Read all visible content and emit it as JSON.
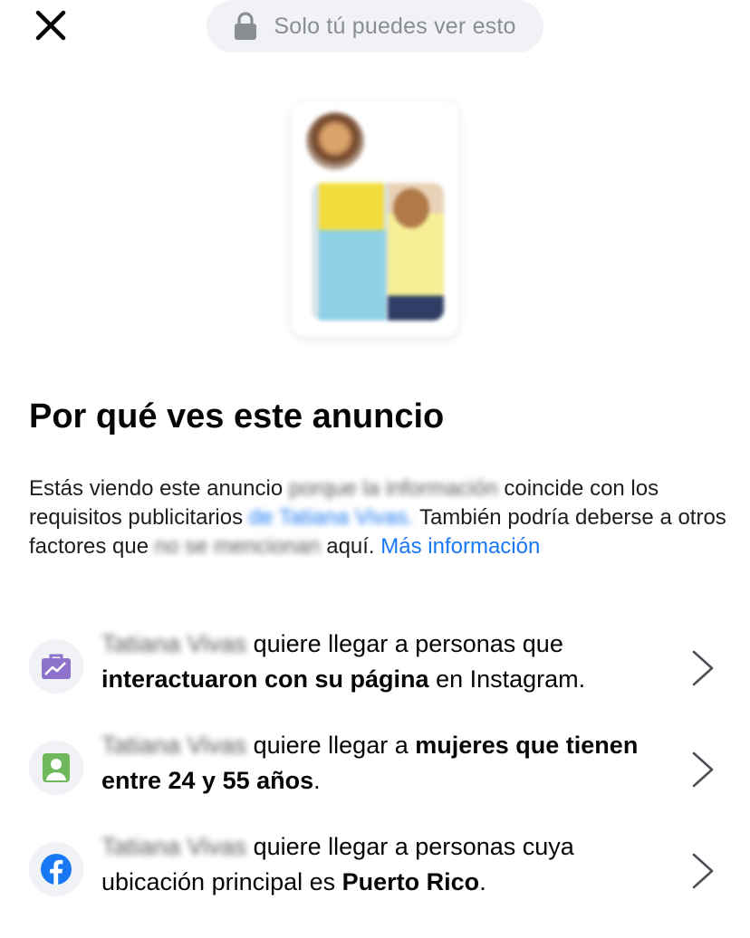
{
  "header": {
    "privacy_label": "Solo tú puedes ver esto"
  },
  "section": {
    "title": "Por qué ves este anuncio"
  },
  "description": {
    "part1": "Estás viendo este anuncio ",
    "blur1": "porque la información",
    "part2": " coincide con los requisitos publicitarios ",
    "blur2": "de Tatiana Vivas.",
    "part3": " También podría deberse a otros factores que ",
    "blur3": "no se mencionan",
    "part4": " aquí. ",
    "more_link": "Más información"
  },
  "reasons": [
    {
      "advertiser": "Tatiana Vivas",
      "text_a": " quiere llegar a personas que ",
      "bold": "interactuaron con su página",
      "text_b": " en Instagram.",
      "icon": "engagement-briefcase-icon",
      "icon_color": "#8c72cb"
    },
    {
      "advertiser": "Tatiana Vivas",
      "text_a": " quiere llegar a ",
      "bold": "mujeres que tienen entre 24 y 55 años",
      "text_b": ".",
      "icon": "person-profile-icon",
      "icon_color": "#6fb85c"
    },
    {
      "advertiser": "Tatiana Vivas",
      "text_a": " quiere llegar a personas cuya ubicación principal es ",
      "bold": "Puerto Rico",
      "text_b": ".",
      "icon": "facebook-icon",
      "icon_color": "#1877f2"
    }
  ],
  "colors": {
    "link": "#1877f2",
    "pill_bg": "#f0f2f5",
    "muted_text": "#8a8d91"
  }
}
